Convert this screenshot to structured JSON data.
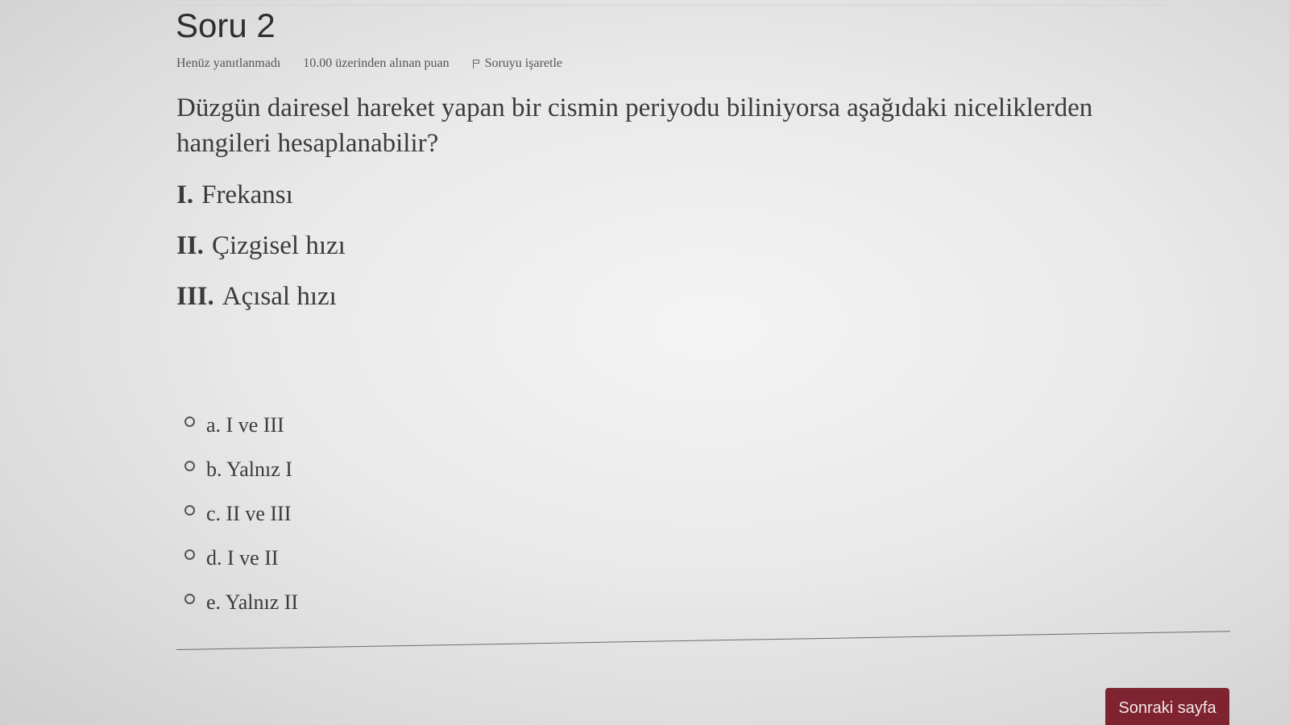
{
  "question": {
    "title": "Soru 2",
    "status": "Henüz yanıtlanmadı",
    "points": "10.00 üzerinden alınan puan",
    "flag_label": "Soruyu işaretle",
    "text": "Düzgün dairesel hareket yapan bir cismin periyodu biliniyorsa aşağıdaki niceliklerden hangileri hesaplanabilir?",
    "items": [
      {
        "num": "I.",
        "text": "Frekansı"
      },
      {
        "num": "II.",
        "text": "Çizgisel hızı"
      },
      {
        "num": "III.",
        "text": "Açısal hızı"
      }
    ],
    "options": [
      {
        "label": "a. I ve III"
      },
      {
        "label": "b. Yalnız I"
      },
      {
        "label": "c. II ve III"
      },
      {
        "label": "d. I ve II"
      },
      {
        "label": "e. Yalnız II"
      }
    ]
  },
  "navigation": {
    "next_label": "Sonraki sayfa"
  },
  "colors": {
    "next_button": "#7d2430",
    "background": "#e9e9e9",
    "text": "#3b3b3b"
  },
  "icons": {
    "flag": "flag-icon",
    "radio": "radio-unchecked-icon"
  }
}
